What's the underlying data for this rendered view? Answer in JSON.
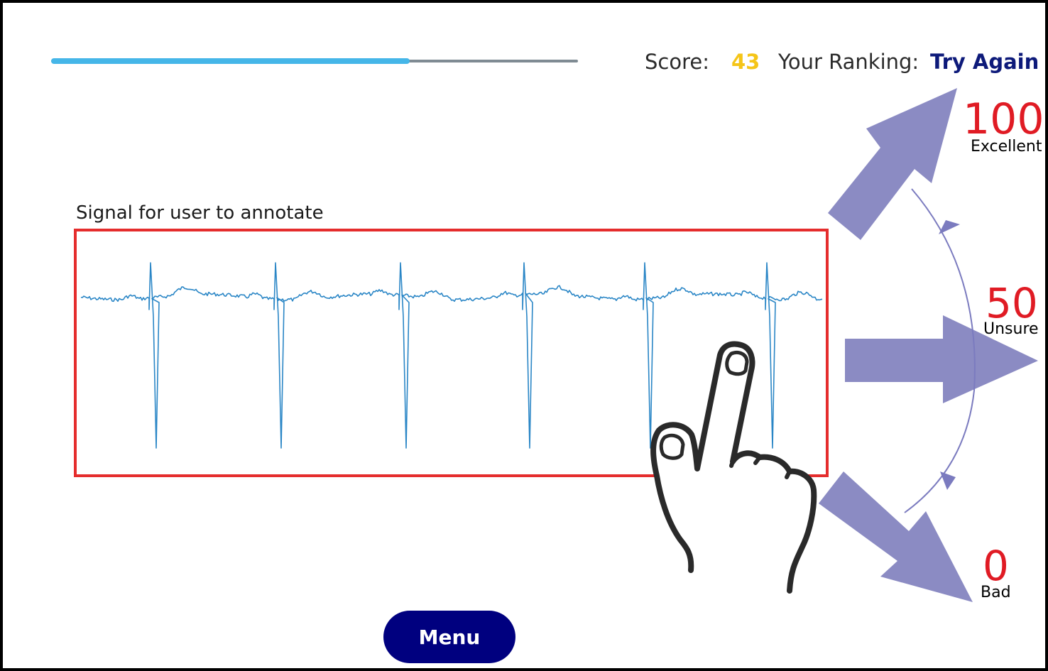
{
  "progress": {
    "value": 0.68,
    "fill_color": "#45b6e8",
    "track_color": "#7f8b93"
  },
  "header": {
    "score_label": "Score:",
    "score_value": "43",
    "score_color": "#f5c518",
    "ranking_label": "Your Ranking:",
    "ranking_value": "Try Again",
    "ranking_color": "#0d1a7a"
  },
  "signal": {
    "caption": "Signal for user to annotate",
    "line_color": "#2a86c6",
    "border_color": "#e52d2d"
  },
  "ratings": [
    {
      "value": "100",
      "label": "Excellent",
      "arrow_direction": "up-right"
    },
    {
      "value": "50",
      "label": "Unsure",
      "arrow_direction": "right"
    },
    {
      "value": "0",
      "label": "Bad",
      "arrow_direction": "down-right"
    }
  ],
  "rating_number_color": "#e01b24",
  "arrow_color": "#8b8bc3",
  "gesture": {
    "icon": "two-finger-hand-icon"
  },
  "menu": {
    "label": "Menu",
    "color": "#00007f"
  }
}
